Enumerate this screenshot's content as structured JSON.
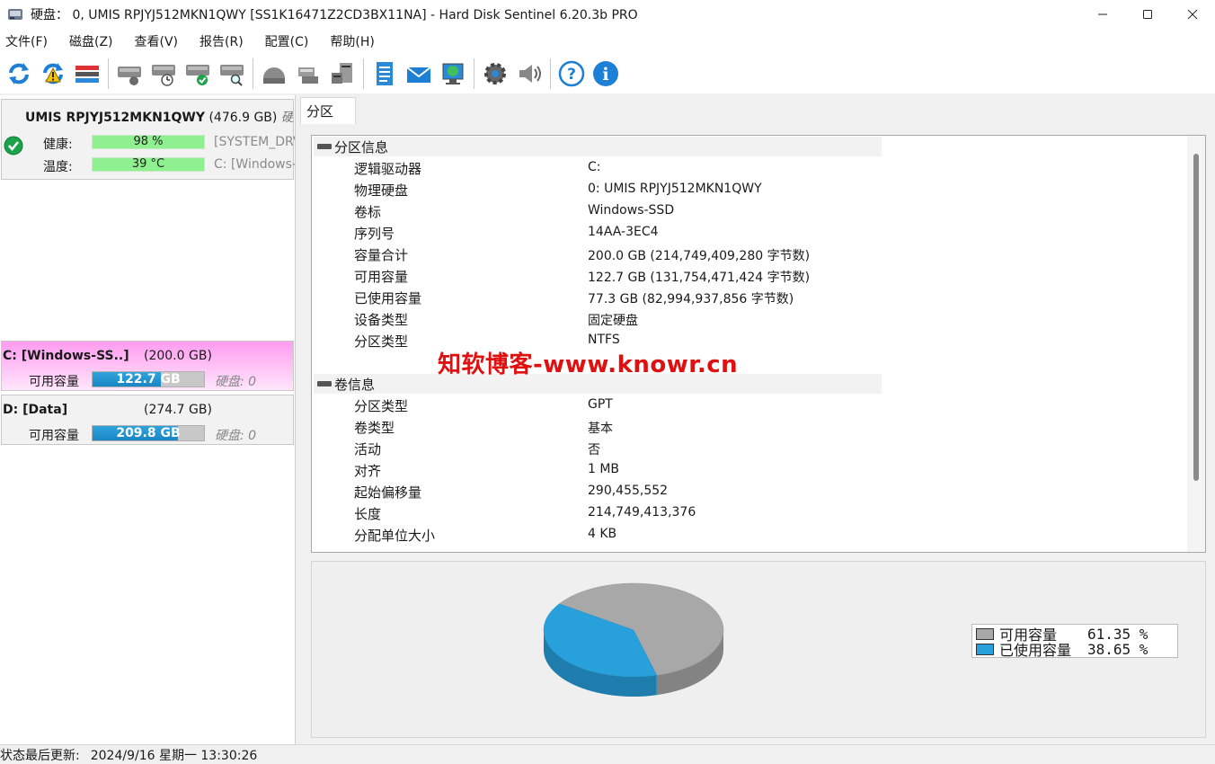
{
  "window": {
    "title": "硬盘：  0, UMIS RPJYJ512MKN1QWY [SS1K16471Z2CD3BX11NA]  -  Hard Disk Sentinel 6.20.3b PRO"
  },
  "menu": [
    "文件(F)",
    "磁盘(Z)",
    "查看(V)",
    "报告(R)",
    "配置(C)",
    "帮助(H)"
  ],
  "toolbar": {
    "icons": [
      "refresh-icon",
      "refresh-warning-icon",
      "disk-list-icon",
      "disk-gray-icon",
      "disk-clock-icon",
      "disk-check-icon",
      "disk-search-icon",
      "disk-dome-icon",
      "network-disk-icon",
      "server-icon",
      "report-icon",
      "email-icon",
      "web-icon",
      "settings-icon",
      "sound-icon",
      "help-icon",
      "info-icon"
    ]
  },
  "disk": {
    "name": "UMIS RPJYJ512MKN1QWY",
    "size": "(476.9 GB)",
    "extra": "硬盘",
    "health_label": "健康:",
    "health_value": "98 %",
    "health_extra": "[SYSTEM_DRV",
    "temp_label": "温度:",
    "temp_value": "39 °C",
    "temp_extra": "C: [Windows-S"
  },
  "partitions": [
    {
      "name": "C: [Windows-SS..]",
      "size": "(200.0 GB)",
      "free_label": "可用容量",
      "free_value": "122.7 GB",
      "free_ratio": 0.6135,
      "disk_label": "硬盘:  0"
    },
    {
      "name": "D: [Data]",
      "size": "(274.7 GB)",
      "free_label": "可用容量",
      "free_value": "209.8 GB",
      "free_ratio": 0.764,
      "disk_label": "硬盘:  0"
    }
  ],
  "tab": "分区",
  "sections": [
    {
      "title": "分区信息",
      "rows": [
        {
          "label": "逻辑驱动器",
          "value": "C:"
        },
        {
          "label": "物理硬盘",
          "value": "0: UMIS RPJYJ512MKN1QWY"
        },
        {
          "label": "卷标",
          "value": "Windows-SSD"
        },
        {
          "label": "序列号",
          "value": "14AA-3EC4"
        },
        {
          "label": "容量合计",
          "value": "200.0 GB (214,749,409,280 字节数)"
        },
        {
          "label": "可用容量",
          "value": "122.7 GB (131,754,471,424 字节数)"
        },
        {
          "label": "已使用容量",
          "value": "77.3 GB (82,994,937,856 字节数)"
        },
        {
          "label": "设备类型",
          "value": "固定硬盘"
        },
        {
          "label": "分区类型",
          "value": "NTFS"
        }
      ]
    },
    {
      "title": "卷信息",
      "rows": [
        {
          "label": "分区类型",
          "value": "GPT"
        },
        {
          "label": "卷类型",
          "value": "基本"
        },
        {
          "label": "活动",
          "value": "否"
        },
        {
          "label": "对齐",
          "value": "1 MB"
        },
        {
          "label": "起始偏移量",
          "value": "290,455,552"
        },
        {
          "label": "长度",
          "value": "214,749,413,376"
        },
        {
          "label": "分配单位大小",
          "value": "4 KB"
        }
      ]
    }
  ],
  "chart_data": {
    "type": "pie",
    "categories": [
      "可用容量",
      "已使用容量"
    ],
    "values": [
      61.35,
      38.65
    ],
    "value_labels": [
      "61.35 %",
      "38.65 %"
    ],
    "colors": [
      "#a8a8a8",
      "#27a0dc"
    ],
    "legend": "right"
  },
  "watermark": "知软博客-www.knowr.cn",
  "status": {
    "label": "状态最后更新:",
    "value": "2024/9/16 星期一 13:30:26"
  }
}
